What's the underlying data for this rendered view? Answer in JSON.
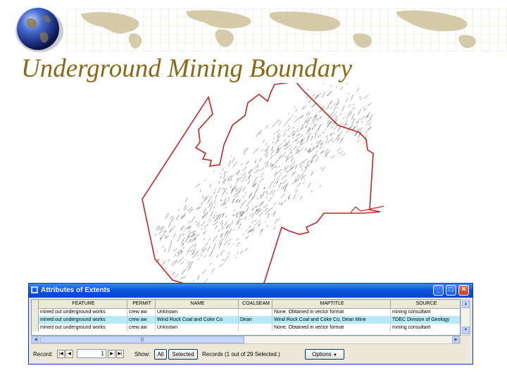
{
  "slide": {
    "title": "Underground Mining Boundary",
    "title_color": "#8b6914",
    "boundary_color": "#cc2222"
  },
  "window": {
    "title": "Attributes of Extents",
    "title_icon": "table-icon",
    "controls": {
      "minimize": "_",
      "maximize": "□",
      "close": "×"
    }
  },
  "table": {
    "columns": [
      "FEATURE",
      "PERMIT",
      "NAME",
      "COALSEAM",
      "MAPTITLE",
      "SOURCE"
    ],
    "rows": [
      {
        "selected": false,
        "cells": [
          "mined out underground works",
          "crew aw",
          "Unknown",
          "",
          "None. Obtained in vector format",
          "mining consultant"
        ]
      },
      {
        "selected": true,
        "cells": [
          "mined out underground works",
          "crew aw",
          "Wind Rock Coal and Coke Co",
          "Dean",
          "Wind Rock Coal and Coke Co, Dean Mine",
          "TDEC Division of Geology"
        ]
      },
      {
        "selected": false,
        "cells": [
          "mined out underground works",
          "crew aw",
          "Unknown",
          "",
          "None. Obtained in vector format",
          "mining consultant"
        ]
      }
    ]
  },
  "footer": {
    "record_label": "Record:",
    "record_value": "1",
    "show_label": "Show:",
    "all_button": "All",
    "selected_button": "Selected",
    "records_text": "Records (1 out of 29 Selected.)",
    "options_button": "Options"
  }
}
